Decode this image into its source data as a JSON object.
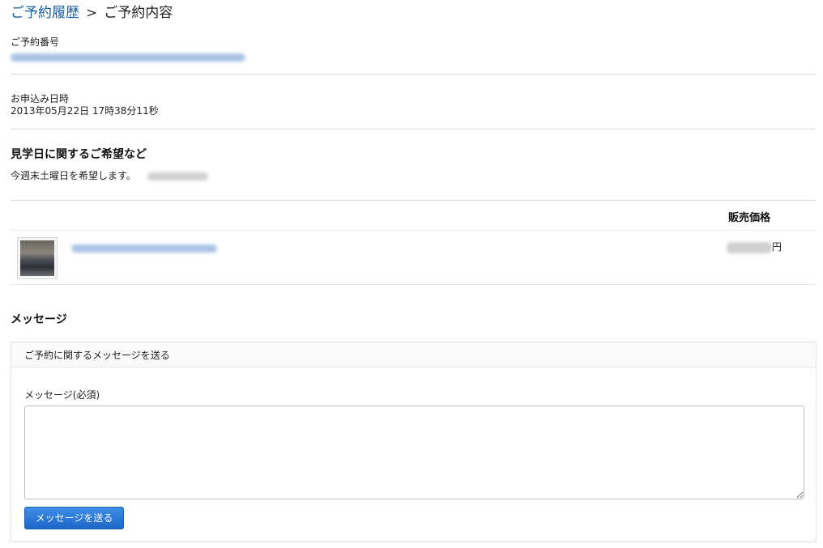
{
  "breadcrumb": {
    "parent": "ご予約履歴",
    "separator": ">",
    "current": "ご予約内容"
  },
  "reservation": {
    "number_label": "ご予約番号",
    "applied_label": "お申込み日時",
    "applied_value": "2013年05月22日 17時38分11秒"
  },
  "visit": {
    "title": "見学日に関するご希望など",
    "text": "今週末土曜日を希望します。"
  },
  "items": {
    "price_header": "販売価格",
    "price_suffix": "円"
  },
  "message": {
    "title": "メッセージ",
    "box_header": "ご予約に関するメッセージを送る",
    "field_label": "メッセージ(必須)",
    "textarea_value": "",
    "send_label": "メッセージを送る"
  },
  "colors": {
    "link": "#1a5fa8",
    "button_top": "#3f8ee6",
    "button_bottom": "#1c66c9",
    "divider": "#dcdcdc"
  }
}
